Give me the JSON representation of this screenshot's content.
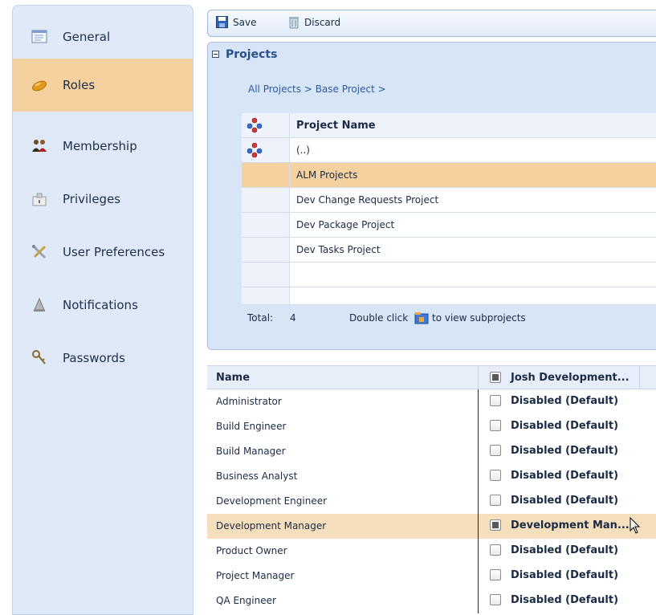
{
  "sidebar": {
    "items": [
      {
        "label": "General",
        "icon": "general-icon"
      },
      {
        "label": "Roles",
        "icon": "roles-icon"
      },
      {
        "label": "Membership",
        "icon": "membership-icon"
      },
      {
        "label": "Privileges",
        "icon": "privileges-icon"
      },
      {
        "label": "User Preferences",
        "icon": "user-preferences-icon"
      },
      {
        "label": "Notifications",
        "icon": "notifications-icon"
      },
      {
        "label": "Passwords",
        "icon": "passwords-icon"
      }
    ],
    "active": "Roles"
  },
  "toolbar": {
    "save_label": "Save",
    "discard_label": "Discard"
  },
  "projects": {
    "title": "Projects",
    "breadcrumb": [
      "All Projects",
      "Base Project"
    ],
    "column_header": "Project Name",
    "rows": [
      "(..)",
      "ALM Projects",
      "Dev Change Requests Project",
      "Dev Package Project",
      "Dev Tasks Project"
    ],
    "selected_row": "ALM Projects",
    "total_label": "Total:",
    "total_value": "4",
    "hint_prefix": "Double click",
    "hint_suffix": "to view subprojects"
  },
  "roles_table": {
    "col_name": "Name",
    "col_project": "Josh Development...",
    "rows": [
      {
        "name": "Administrator",
        "value": "Disabled (Default)"
      },
      {
        "name": "Build Engineer",
        "value": "Disabled (Default)"
      },
      {
        "name": "Build Manager",
        "value": "Disabled (Default)"
      },
      {
        "name": "Business Analyst",
        "value": "Disabled (Default)"
      },
      {
        "name": "Development Engineer",
        "value": "Disabled (Default)"
      },
      {
        "name": "Development Manager",
        "value": "Development Man..."
      },
      {
        "name": "Product Owner",
        "value": "Disabled (Default)"
      },
      {
        "name": "Project Manager",
        "value": "Disabled (Default)"
      },
      {
        "name": "QA Engineer",
        "value": "Disabled (Default)"
      }
    ],
    "selected_row": "Development Manager"
  },
  "colors": {
    "sidebar_bg": "#dfe9f8",
    "active_highlight": "#f4d19e",
    "panel_bg": "#d8e5f6",
    "link": "#2c5aa0"
  }
}
